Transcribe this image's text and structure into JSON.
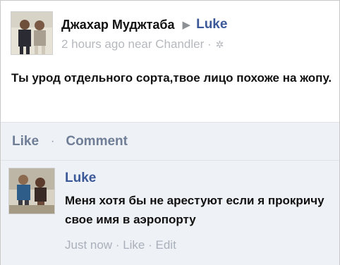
{
  "post": {
    "author": "Джахар Муджтаба",
    "target": "Luke",
    "meta": "2 hours ago near Chandler ·",
    "text": "Ты урод отдельного сорта,твое лицо похоже на жопу.",
    "avatar_icon": "profile-photo",
    "privacy_icon": "gear-icon"
  },
  "actions": {
    "like": "Like",
    "separator": "·",
    "comment": "Comment"
  },
  "comment": {
    "author": "Luke",
    "text": "Меня хотя бы не арестуют если я прокричу свое имя в аэропорту",
    "time": "Just now",
    "sep1": " · ",
    "like": "Like",
    "sep2": " · ",
    "edit": "Edit",
    "avatar_icon": "profile-photo"
  },
  "colors": {
    "link_blue": "#3b5998",
    "action_gray": "#6f7e96",
    "meta_gray": "#b5b8bd",
    "panel_bg": "#eef1f5"
  }
}
